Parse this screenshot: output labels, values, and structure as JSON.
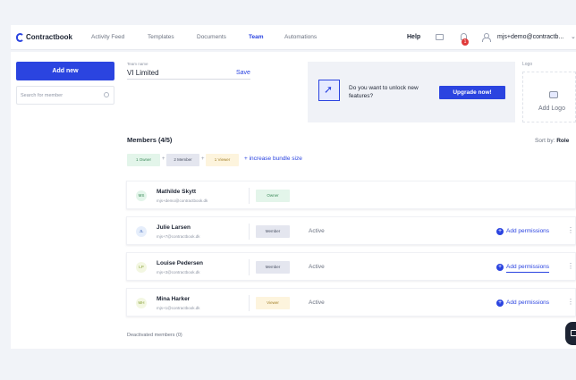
{
  "nav": {
    "brand": "Contractbook",
    "items": [
      {
        "label": "Activity Feed",
        "active": false
      },
      {
        "label": "Templates",
        "active": false
      },
      {
        "label": "Documents",
        "active": false
      },
      {
        "label": "Team",
        "active": true
      },
      {
        "label": "Automations",
        "active": false
      }
    ],
    "help": "Help",
    "notification_count": "1",
    "user_email": "mjs+demo@contractb...",
    "chevron": "⌄"
  },
  "sidebar": {
    "add_new": "Add new",
    "search_placeholder": "Search for member"
  },
  "team": {
    "label": "Team name",
    "value": "VI Limited",
    "save": "Save"
  },
  "upsell": {
    "text": "Do you want to unlock new features?",
    "button": "Upgrade now!"
  },
  "logo": {
    "label": "Logo",
    "add": "Add Logo"
  },
  "members": {
    "title": "Members (4/5)",
    "sort_label": "Sort by:",
    "sort_value": "Role",
    "pills": [
      {
        "label": "1 Owner",
        "bg": "#e3f5ea",
        "fg": "#3c8a5a"
      },
      {
        "label": "2 Member",
        "bg": "#e4e6ef",
        "fg": "#4a5163"
      },
      {
        "label": "1 Viewer",
        "bg": "#fdf4dd",
        "fg": "#a3812b"
      }
    ],
    "plus": "+",
    "bundle": "+ increase bundle size",
    "rows": [
      {
        "initials": "MS",
        "name": "Mathilde Skytt",
        "email": "mjs+demo@contractbook.dk",
        "role": "Owner",
        "role_bg": "#e3f5ea",
        "role_fg": "#3c8a5a",
        "avatar_bg": "#e3f5ea",
        "avatar_fg": "#3c8a5a",
        "status": "",
        "permissions": ""
      },
      {
        "initials": "JL",
        "name": "Julie Larsen",
        "email": "mjs+7@contractbook.dk",
        "role": "Member",
        "role_bg": "#e4e6ef",
        "role_fg": "#4a5163",
        "avatar_bg": "#e6eefb",
        "avatar_fg": "#4a6fbf",
        "status": "Active",
        "permissions": "Add permissions"
      },
      {
        "initials": "LP",
        "name": "Louise Pedersen",
        "email": "mjs+3@contractbook.dk",
        "role": "Member",
        "role_bg": "#e4e6ef",
        "role_fg": "#4a5163",
        "avatar_bg": "#f3f7e2",
        "avatar_fg": "#8aa23a",
        "status": "Active",
        "permissions": "Add permissions"
      },
      {
        "initials": "MH",
        "name": "Mina Harker",
        "email": "mjs+1@contractbook.dk",
        "role": "Viewer",
        "role_bg": "#fdf4dd",
        "role_fg": "#a3812b",
        "avatar_bg": "#f3f7e2",
        "avatar_fg": "#8aa23a",
        "status": "Active",
        "permissions": "Add permissions"
      }
    ],
    "deactivated": "Deactivated members (0)"
  },
  "colors": {
    "accent": "#2b44e0",
    "danger": "#e03a3a"
  }
}
